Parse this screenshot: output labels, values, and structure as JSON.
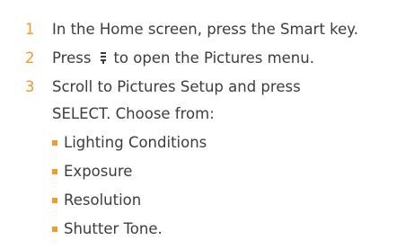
{
  "colors": {
    "accent": "#f39a2a",
    "text": "#3c3c3c"
  },
  "steps": [
    {
      "number": "1",
      "text": "In the Home screen, press the Smart key."
    },
    {
      "number": "2",
      "text_before": "Press",
      "icon": "menu-key-icon",
      "text_after": "to open the Pictures menu."
    },
    {
      "number": "3",
      "text": "Scroll to Pictures Setup and press",
      "text_line2": "SELECT. Choose from:",
      "options": [
        "Lighting Conditions",
        "Exposure",
        "Resolution",
        "Shutter Tone."
      ]
    }
  ]
}
